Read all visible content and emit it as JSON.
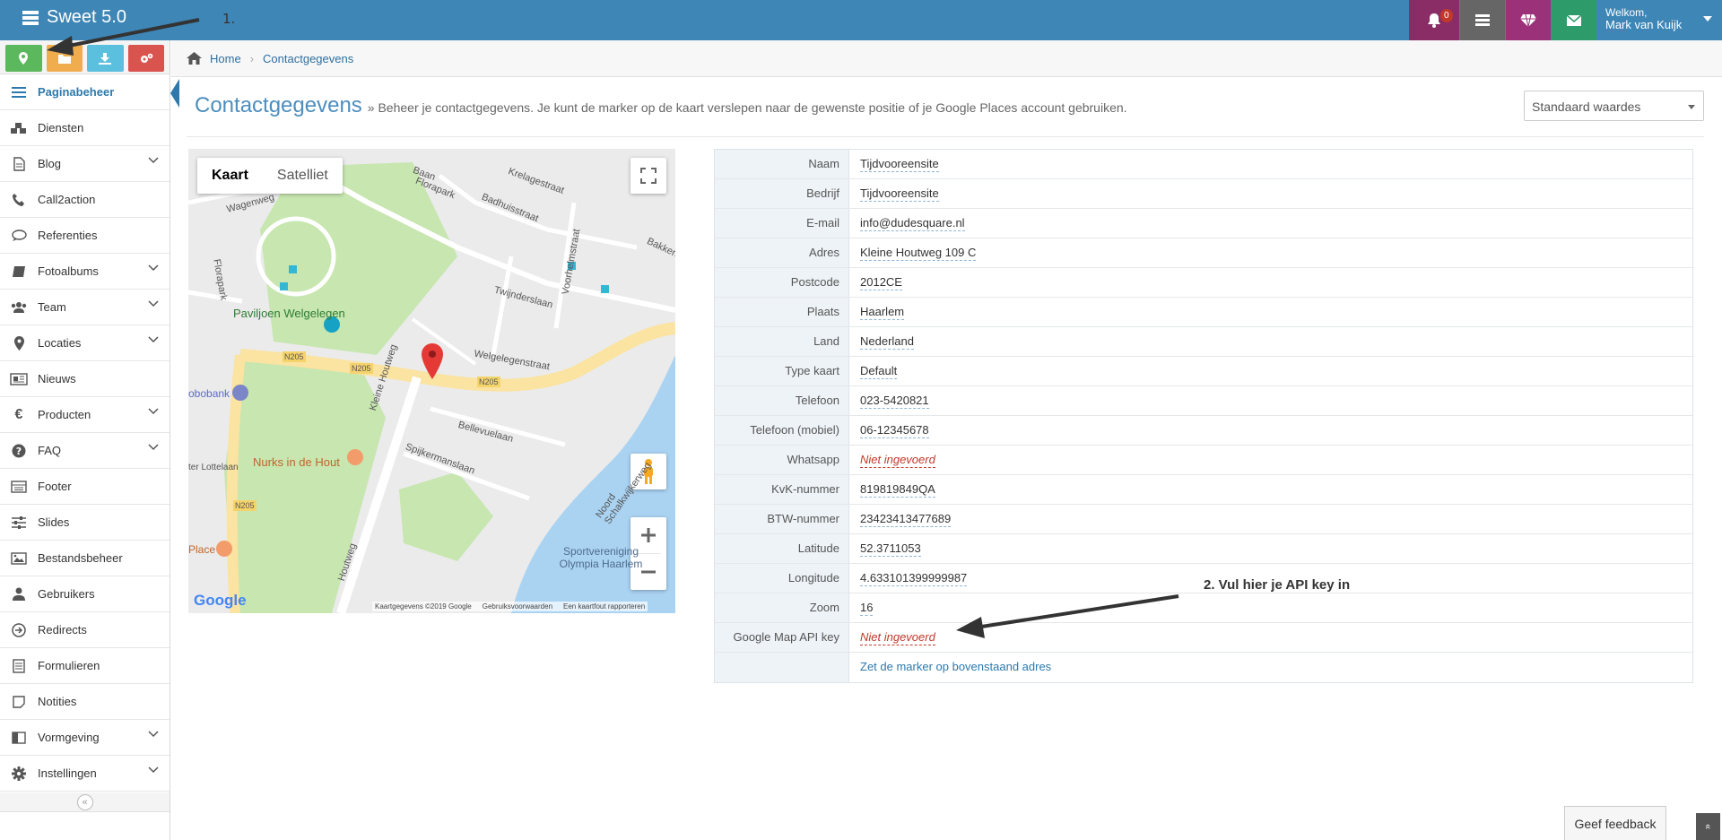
{
  "app": {
    "title": "Sweet 5.0"
  },
  "annotations": {
    "step1": "1.",
    "step2": "2. Vul hier je API key in"
  },
  "topbar": {
    "notifications_count": "0",
    "welcome_label": "Welkom,",
    "user_name": "Mark van Kuijk",
    "colors": {
      "bar": "#3e86b6",
      "bell": "#8a2c66",
      "stack": "#666666",
      "gem": "#9b3178",
      "mail": "#2e9b6a"
    }
  },
  "sidebar": {
    "quick_buttons": [
      {
        "icon": "map-marker-icon",
        "color": "#5cb85c"
      },
      {
        "icon": "folder-icon",
        "color": "#f0ad4e"
      },
      {
        "icon": "download-icon",
        "color": "#5bc0de"
      },
      {
        "icon": "cogs-icon",
        "color": "#d9534f"
      }
    ],
    "items": [
      {
        "label": "Paginabeheer",
        "icon": "bars-icon",
        "active": true
      },
      {
        "label": "Diensten",
        "icon": "cubes-icon"
      },
      {
        "label": "Blog",
        "icon": "file-text-icon",
        "expandable": true
      },
      {
        "label": "Call2action",
        "icon": "phone-volume-icon"
      },
      {
        "label": "Referenties",
        "icon": "comment-icon"
      },
      {
        "label": "Fotoalbums",
        "icon": "book-icon",
        "expandable": true
      },
      {
        "label": "Team",
        "icon": "users-icon",
        "expandable": true
      },
      {
        "label": "Locaties",
        "icon": "map-marker-icon",
        "expandable": true
      },
      {
        "label": "Nieuws",
        "icon": "newspaper-icon"
      },
      {
        "label": "Producten",
        "icon": "euro-icon",
        "expandable": true
      },
      {
        "label": "FAQ",
        "icon": "question-circle-icon",
        "expandable": true
      },
      {
        "label": "Footer",
        "icon": "list-alt-icon"
      },
      {
        "label": "Slides",
        "icon": "sliders-icon"
      },
      {
        "label": "Bestandsbeheer",
        "icon": "image-icon"
      },
      {
        "label": "Gebruikers",
        "icon": "user-icon"
      },
      {
        "label": "Redirects",
        "icon": "arrow-circle-right-icon"
      },
      {
        "label": "Formulieren",
        "icon": "list-icon"
      },
      {
        "label": "Notities",
        "icon": "sticky-note-icon"
      },
      {
        "label": "Vormgeving",
        "icon": "columns-icon",
        "expandable": true
      },
      {
        "label": "Instellingen",
        "icon": "cog-icon",
        "expandable": true
      }
    ]
  },
  "breadcrumb": {
    "home": "Home",
    "current": "Contactgegevens"
  },
  "page": {
    "title": "Contactgegevens",
    "subtitle": "» Beheer je contactgegevens. Je kunt de marker op de kaart verslepen naar de gewenste positie of je Google Places account gebruiken.",
    "preset_select": "Standaard waardes"
  },
  "map": {
    "type_tabs": [
      "Kaart",
      "Satelliet"
    ],
    "logo": "Google",
    "footer": [
      "Kaartgegevens ©2019 Google",
      "Gebruiksvoorwaarden",
      "Een kaartfout rapporteren"
    ],
    "labels": {
      "park": "Paviljoen Welgelegen",
      "restaurant": "Nurks in de Hout",
      "sport": "Sportvereniging Olympia Haarlem",
      "road1": "N205",
      "road2": "N205",
      "road3": "N205",
      "road4": "N205",
      "street1": "Kleine Houtweg",
      "street2": "Welgelegenstraat",
      "street3": "Bellevuelaan",
      "street4": "Spijkermanslaan",
      "street5": "Twijnderslaan",
      "street6": "Voorhelmstraat",
      "street7": "Badhuisstraat",
      "street8": "Krelagestraat",
      "street9": "Florapark",
      "street10": "Wagenweg",
      "street11": "Bakkers",
      "street12": "Noord Schalkwijkerweg",
      "street13": "Baan",
      "street14": "Florapark",
      "street15": "ter Lottelaan",
      "place1": "obobank",
      "place2": "Place",
      "street16": "Houtweg"
    }
  },
  "details": {
    "rows": [
      {
        "label": "Naam",
        "value": "Tijdvooreensite"
      },
      {
        "label": "Bedrijf",
        "value": "Tijdvooreensite"
      },
      {
        "label": "E-mail",
        "value": "info@dudesquare.nl"
      },
      {
        "label": "Adres",
        "value": "Kleine Houtweg 109 C"
      },
      {
        "label": "Postcode",
        "value": "2012CE"
      },
      {
        "label": "Plaats",
        "value": "Haarlem"
      },
      {
        "label": "Land",
        "value": "Nederland"
      },
      {
        "label": "Type kaart",
        "value": "Default"
      },
      {
        "label": "Telefoon",
        "value": "023-5420821"
      },
      {
        "label": "Telefoon (mobiel)",
        "value": "06-12345678"
      },
      {
        "label": "Whatsapp",
        "value": "Niet ingevoerd",
        "empty": true
      },
      {
        "label": "KvK-nummer",
        "value": "819819849QA"
      },
      {
        "label": "BTW-nummer",
        "value": "23423413477689"
      },
      {
        "label": "Latitude",
        "value": "52.3711053"
      },
      {
        "label": "Longitude",
        "value": "4.633101399999987"
      },
      {
        "label": "Zoom",
        "value": "16"
      },
      {
        "label": "Google Map API key",
        "value": "Niet ingevoerd",
        "empty": true
      }
    ],
    "marker_link": "Zet de marker op bovenstaand adres"
  },
  "footer": {
    "feedback": "Geef feedback"
  }
}
